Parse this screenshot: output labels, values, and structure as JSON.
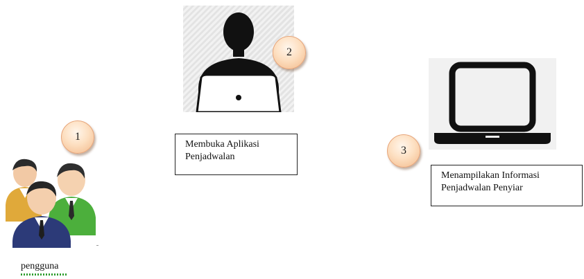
{
  "steps": [
    {
      "number": "1",
      "label": "pengguna"
    },
    {
      "number": "2",
      "label": "Membuka Aplikasi Penjadwalan",
      "lines": [
        "Membuka Aplikasi",
        "Penjadwalan"
      ]
    },
    {
      "number": "3",
      "label": "Menampilakan Informasi Penjadwalan Penyiar",
      "lines": [
        "Menampilakan Informasi",
        "Penjadwalan Penyiar"
      ]
    }
  ],
  "icons": {
    "users": "group-of-users-icon",
    "person": "person-at-laptop-icon",
    "laptop": "laptop-icon"
  },
  "colors": {
    "badge_fill": "#fde0c2",
    "badge_edge": "#f3b98a",
    "spellcheck_underline": "#2e9d2e"
  }
}
